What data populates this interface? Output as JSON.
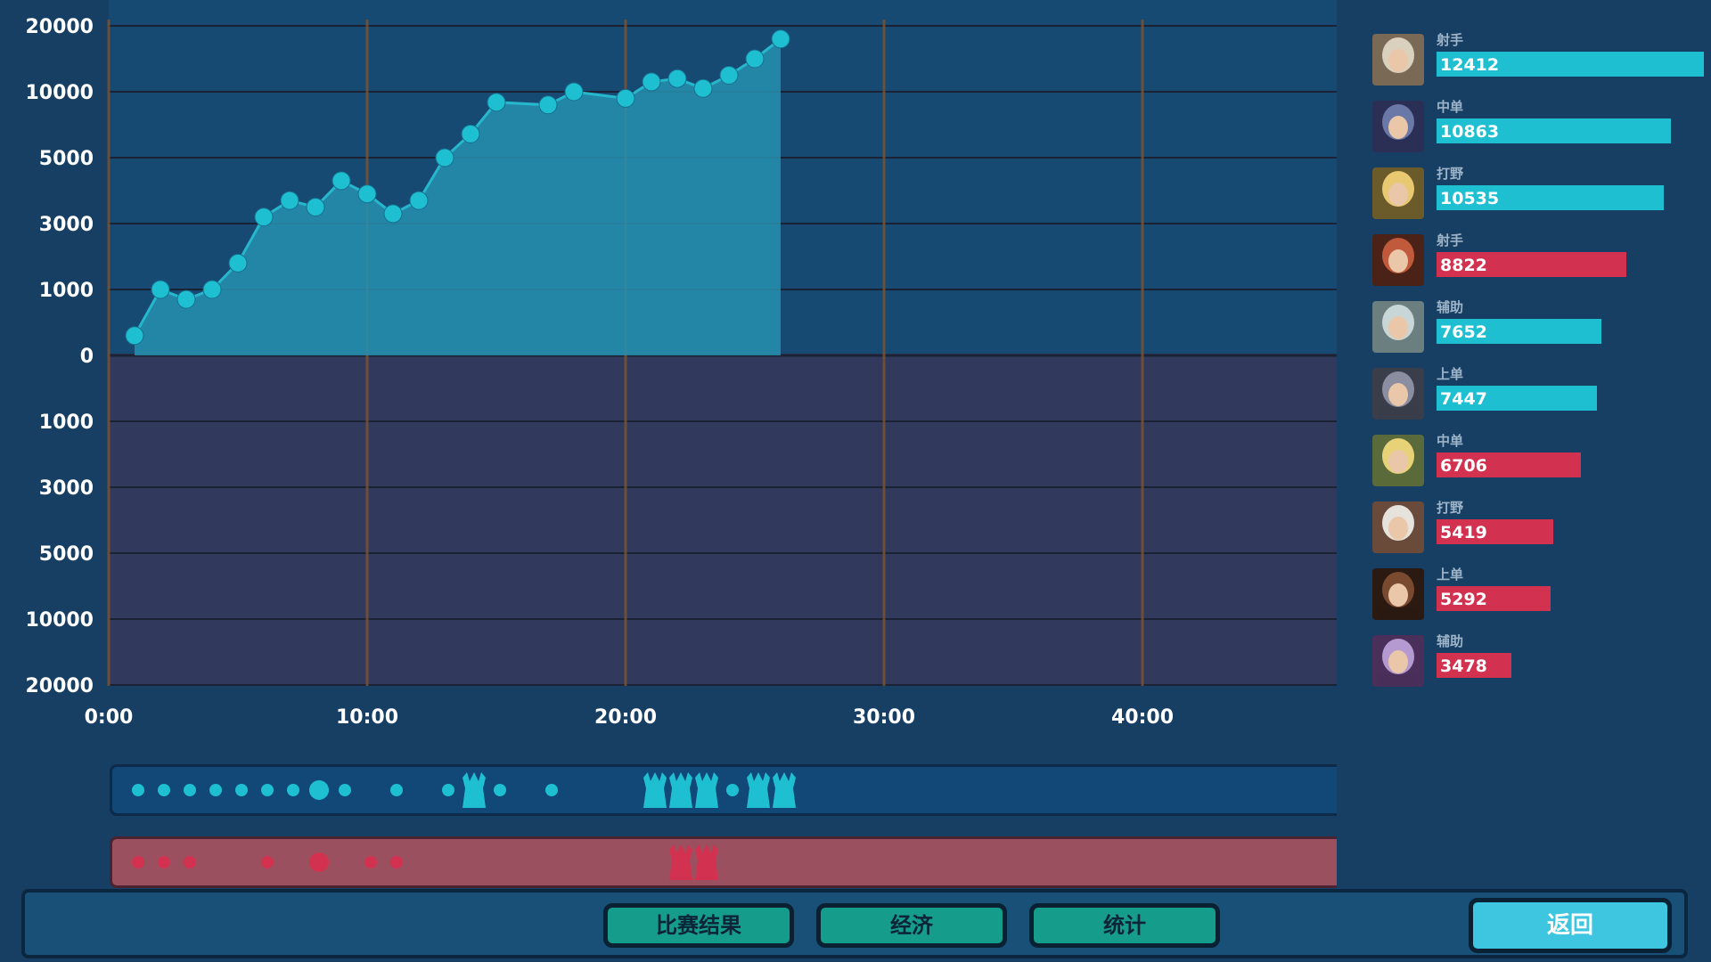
{
  "chart_data": {
    "type": "area",
    "y_tick_labels": [
      "20000",
      "10000",
      "5000",
      "3000",
      "1000",
      "0",
      "1000",
      "3000",
      "5000",
      "10000",
      "20000"
    ],
    "x_tick_labels": [
      "0:00",
      "10:00",
      "20:00",
      "30:00",
      "40:00"
    ],
    "ylim": [
      -20000,
      20000
    ],
    "y_scale": "nonlinear (tick labels as shown)",
    "grid": true,
    "series": [
      {
        "color": "#2a9fc0",
        "x_minutes": [
          1,
          2,
          3,
          4,
          5,
          6,
          7,
          8,
          9,
          10,
          11,
          12,
          13,
          14,
          15,
          17,
          18,
          20,
          21,
          22,
          23,
          24,
          25,
          26
        ],
        "values": [
          300,
          1000,
          850,
          1000,
          1800,
          3200,
          3700,
          3500,
          4300,
          3900,
          3300,
          3700,
          5000,
          6800,
          9200,
          9000,
          10000,
          9500,
          11500,
          12000,
          10500,
          12500,
          15000,
          18000
        ]
      }
    ],
    "colors": {
      "blue_team": "#1fbfd2",
      "red_team": "#d2324f",
      "positive_fill": "#2790b0",
      "negative_bg": "#313a5d",
      "grid_line": "#1a2233",
      "vertical_line": "#7a5232"
    }
  },
  "timeline": {
    "blue_events": [
      {
        "minute": 1,
        "kind": "kill"
      },
      {
        "minute": 2,
        "kind": "kill"
      },
      {
        "minute": 3,
        "kind": "kill"
      },
      {
        "minute": 4,
        "kind": "kill"
      },
      {
        "minute": 5,
        "kind": "kill"
      },
      {
        "minute": 6,
        "kind": "kill"
      },
      {
        "minute": 7,
        "kind": "kill"
      },
      {
        "minute": 8,
        "kind": "big-kill"
      },
      {
        "minute": 9,
        "kind": "kill"
      },
      {
        "minute": 11,
        "kind": "kill"
      },
      {
        "minute": 13,
        "kind": "kill"
      },
      {
        "minute": 14,
        "kind": "tower"
      },
      {
        "minute": 15,
        "kind": "kill"
      },
      {
        "minute": 17,
        "kind": "kill"
      },
      {
        "minute": 21,
        "kind": "tower"
      },
      {
        "minute": 22,
        "kind": "tower"
      },
      {
        "minute": 23,
        "kind": "tower"
      },
      {
        "minute": 24,
        "kind": "kill"
      },
      {
        "minute": 25,
        "kind": "tower"
      },
      {
        "minute": 26,
        "kind": "tower"
      }
    ],
    "red_events": [
      {
        "minute": 1,
        "kind": "kill"
      },
      {
        "minute": 2,
        "kind": "kill"
      },
      {
        "minute": 3,
        "kind": "kill"
      },
      {
        "minute": 6,
        "kind": "kill"
      },
      {
        "minute": 8,
        "kind": "big-kill"
      },
      {
        "minute": 10,
        "kind": "kill"
      },
      {
        "minute": 11,
        "kind": "kill"
      },
      {
        "minute": 22,
        "kind": "tower"
      },
      {
        "minute": 23,
        "kind": "tower"
      }
    ]
  },
  "players": [
    {
      "role": "射手",
      "value": "12412",
      "team": "blue",
      "avatar": "old-warrior-avatar"
    },
    {
      "role": "中单",
      "value": "10863",
      "team": "blue",
      "avatar": "goggles-mage-avatar"
    },
    {
      "role": "打野",
      "value": "10535",
      "team": "blue",
      "avatar": "golden-fox-avatar"
    },
    {
      "role": "射手",
      "value": "8822",
      "team": "red",
      "avatar": "redhead-archer-avatar"
    },
    {
      "role": "辅助",
      "value": "7652",
      "team": "blue",
      "avatar": "silver-support-avatar"
    },
    {
      "role": "上单",
      "value": "7447",
      "team": "blue",
      "avatar": "armored-knight-avatar"
    },
    {
      "role": "中单",
      "value": "6706",
      "team": "red",
      "avatar": "blonde-boy-avatar"
    },
    {
      "role": "打野",
      "value": "5419",
      "team": "red",
      "avatar": "white-hair-avatar"
    },
    {
      "role": "上单",
      "value": "5292",
      "team": "red",
      "avatar": "bearded-brute-avatar"
    },
    {
      "role": "辅助",
      "value": "3478",
      "team": "red",
      "avatar": "purple-hair-avatar"
    }
  ],
  "bottom_nav": {
    "tab_result": "比赛结果",
    "tab_economy": "经济",
    "tab_stats": "统计",
    "back": "返回"
  }
}
